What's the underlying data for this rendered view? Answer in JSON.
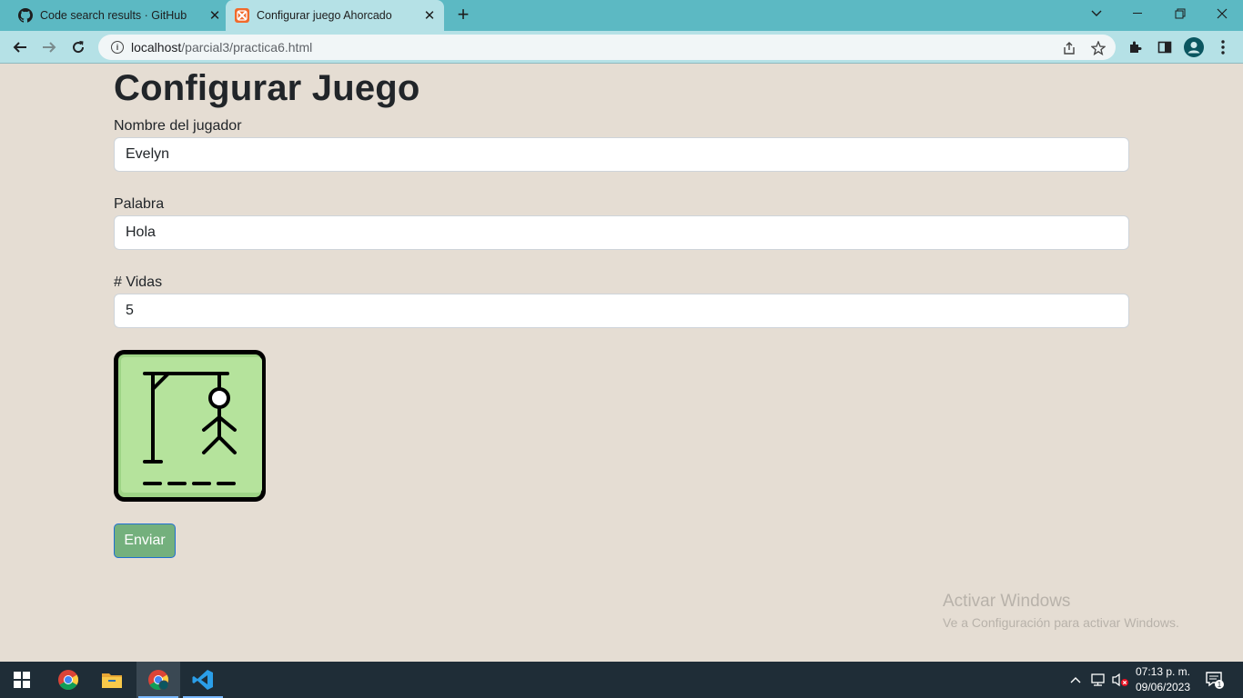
{
  "browser": {
    "tabs": [
      {
        "title": "Code search results · GitHub",
        "icon": "github-icon",
        "active": false
      },
      {
        "title": "Configurar juego Ahorcado",
        "icon": "xampp-icon",
        "active": true
      }
    ],
    "url_host": "localhost",
    "url_path": "/parcial3/practica6.html"
  },
  "page": {
    "title": "Configurar Juego",
    "fields": [
      {
        "label": "Nombre del jugador",
        "value": "Evelyn"
      },
      {
        "label": "Palabra",
        "value": "Hola"
      },
      {
        "label": "# Vidas",
        "value": "5"
      }
    ],
    "submit_label": "Enviar"
  },
  "watermark": {
    "line1": "Activar Windows",
    "line2": "Ve a Configuración para activar Windows."
  },
  "taskbar": {
    "apps": [
      "windows-start-icon",
      "chrome-icon",
      "file-explorer-icon",
      "chrome-profile-icon",
      "vscode-icon"
    ],
    "time": "07:13 p. m.",
    "date": "09/06/2023",
    "notification_count": "1"
  },
  "colors": {
    "tab_bar": "#5cb9c3",
    "toolbar": "#b5e1e6",
    "page_bg": "#e5ddd3",
    "button": "#74b07d",
    "hangman_bg": "#b5e39c"
  }
}
